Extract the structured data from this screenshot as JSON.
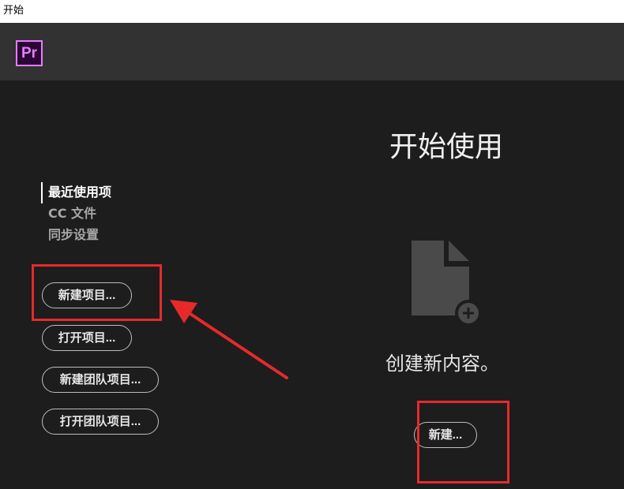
{
  "window": {
    "title": "开始"
  },
  "app": {
    "logo_text": "Pr"
  },
  "nav": {
    "items": [
      {
        "label": "最近使用项",
        "active": true
      },
      {
        "label": "CC 文件",
        "active": false
      },
      {
        "label": "同步设置",
        "active": false
      }
    ]
  },
  "buttons": {
    "new_project": "新建项目...",
    "open_project": "打开项目...",
    "new_team_project": "新建团队项目...",
    "open_team_project": "打开团队项目...",
    "new": "新建..."
  },
  "main": {
    "heading": "开始使用",
    "create_text": "创建新内容。"
  },
  "icons": {
    "logo": "premiere-pro-logo",
    "document": "new-document-icon",
    "plus": "plus-circle-icon"
  },
  "colors": {
    "background": "#1d1d1d",
    "topbar": "#323232",
    "logo_accent": "#e77cff",
    "annotation": "#e62a2a"
  }
}
